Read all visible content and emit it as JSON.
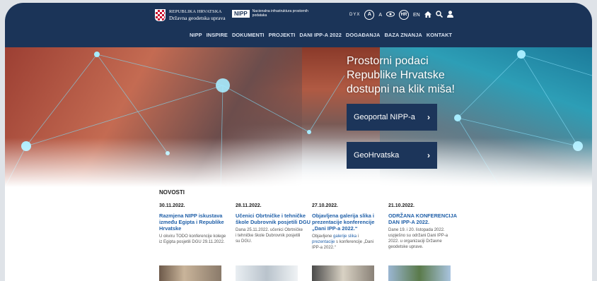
{
  "header": {
    "brand_line1": "REPUBLIKA HRVATSKA",
    "brand_line2": "Državna geodetska uprava",
    "nipp_logo": "NIPP",
    "nipp_sub": "Nacionalna infrastruktura prostornih podataka",
    "access": {
      "dyx": "DYX",
      "a_circle": "A",
      "a_plain": "A",
      "eye_icon": "eye-icon",
      "hr": "HR",
      "en": "EN",
      "home_icon": "home-icon",
      "search_icon": "search-icon",
      "user_icon": "user-icon"
    }
  },
  "nav": [
    "NIPP",
    "INSPIRE",
    "DOKUMENTI",
    "PROJEKTI",
    "DANI IPP-A 2022",
    "DOGAĐANJA",
    "BAZA ZNANJA",
    "KONTAKT"
  ],
  "hero": {
    "headline": "Prostorni podaci Republike Hrvatske dostupni na klik miša!",
    "button1": "Geoportal NIPP-a",
    "button2": "GeoHrvatska",
    "chevron": "›"
  },
  "news": {
    "heading": "NOVOSTI",
    "items": [
      {
        "date": "30.11.2022.",
        "title": "Razmjena NIPP iskustava između Egipta i Republike Hrvatske",
        "text": "U okviru TODO konferencije kolege iz Egipta posjetili DGU 29.11.2022."
      },
      {
        "date": "28.11.2022.",
        "title": "Učenici Obrtničke i tehničke škole Dubrovnik posjetili DGU",
        "text": "Dana 25.11.2022. učenici Obrtničke i tehničke škole Dubrovnik posjetili su DGU."
      },
      {
        "date": "27.10.2022.",
        "title": "Objavljena galerija slika i prezentacije konferencije „Dani IPP-a 2022.“",
        "text_pre": "Objavljene ",
        "text_link1": "galerije slika",
        "text_mid": " i ",
        "text_link2": "prezentacije",
        "text_post": " s konferencije „Dani IPP-a 2022.“"
      },
      {
        "date": "21.10.2022.",
        "title": "ODRŽANA KONFERENCIJA DAN IPP-A 2022.",
        "text": "Dane 19. i 20. listopada 2022. uspješno su održani Dani IPP-a 2022. u organizaciji Državne geodetske uprave."
      }
    ]
  },
  "colors": {
    "navy": "#1b3458",
    "link": "#1f5fa8"
  }
}
